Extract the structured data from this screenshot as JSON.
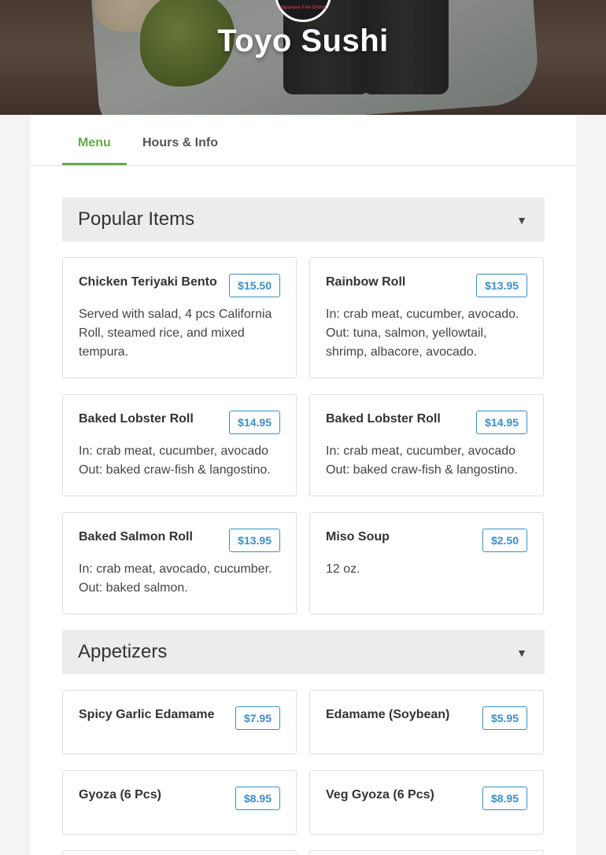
{
  "restaurant": {
    "name": "Toyo Sushi",
    "logo_text": "Japanese Fine Dining"
  },
  "tabs": [
    {
      "label": "Menu",
      "active": true
    },
    {
      "label": "Hours & Info",
      "active": false
    }
  ],
  "colors": {
    "accent_green": "#6aa84f",
    "price_blue": "#3a8fc6",
    "section_bg": "#ececec"
  },
  "sections": [
    {
      "title": "Popular Items",
      "toggle_icon": "▼",
      "items": [
        {
          "name": "Chicken Teriyaki Bento",
          "price": "$15.50",
          "desc": "Served with salad, 4 pcs California Roll, steamed rice, and mixed tempura."
        },
        {
          "name": "Rainbow Roll",
          "price": "$13.95",
          "desc": "In: crab meat, cucumber, avocado. Out: tuna, salmon, yellowtail, shrimp, albacore, avocado."
        },
        {
          "name": "Baked Lobster Roll",
          "price": "$14.95",
          "desc": "In: crab meat, cucumber, avocado Out: baked craw-fish & langostino."
        },
        {
          "name": "Baked Lobster Roll",
          "price": "$14.95",
          "desc": "In: crab meat, cucumber, avocado Out: baked craw-fish & langostino."
        },
        {
          "name": "Baked Salmon Roll",
          "price": "$13.95",
          "desc": "In: crab meat, avocado, cucumber. Out: baked salmon."
        },
        {
          "name": "Miso Soup",
          "price": "$2.50",
          "desc": "12 oz."
        }
      ]
    },
    {
      "title": "Appetizers",
      "toggle_icon": "▼",
      "items": [
        {
          "name": "Spicy Garlic Edamame",
          "price": "$7.95",
          "desc": ""
        },
        {
          "name": "Edamame (Soybean)",
          "price": "$5.95",
          "desc": ""
        },
        {
          "name": "Gyoza (6 Pcs)",
          "price": "$8.95",
          "desc": ""
        },
        {
          "name": "Veg Gyoza (6 Pcs)",
          "price": "$8.95",
          "desc": ""
        }
      ]
    }
  ]
}
